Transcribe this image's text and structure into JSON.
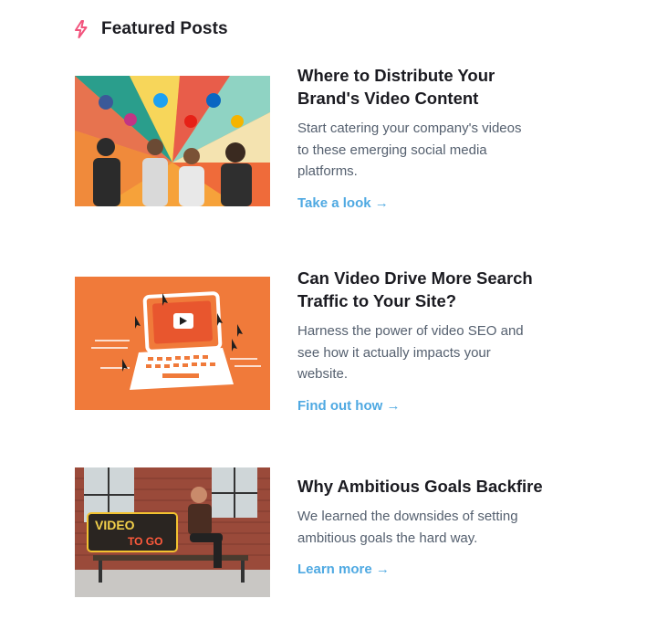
{
  "header": {
    "title": "Featured Posts",
    "icon": "lightning-bolt-icon",
    "icon_color": "#f2547d"
  },
  "accent_color": "#4fa9e2",
  "posts": [
    {
      "title_line1": "Where to Distribute Your",
      "title_line2": "Brand's Video Content",
      "desc_line1": "Start catering your company's videos",
      "desc_line2": "to these emerging social media",
      "desc_line3": "platforms.",
      "cta": "Take a look →",
      "image": "people-looking-up-at-social-media-icons"
    },
    {
      "title_line1": "Can Video Drive More Search",
      "title_line2": "Traffic to Your Site?",
      "desc_line1": "Harness the power of video SEO and",
      "desc_line2": "see how it actually impacts your",
      "desc_line3": "website.",
      "cta": "Find out how →",
      "image": "laptop-with-play-button-and-cursors"
    },
    {
      "title_line1": "Why Ambitious Goals Backfire",
      "desc_line1": "We learned the downsides of setting",
      "desc_line2": "ambitious goals the hard way.",
      "cta": "Learn more →",
      "image": "man-on-bench-with-neon-sign",
      "sign_line1": "VIDEO",
      "sign_line2": "TO GO"
    }
  ]
}
